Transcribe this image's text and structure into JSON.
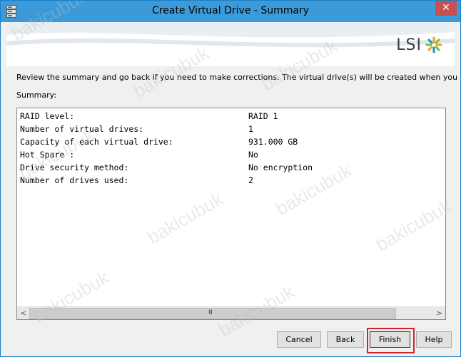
{
  "window": {
    "title": "Create Virtual Drive - Summary",
    "close_glyph": "✕",
    "app_icon": "server-stack-icon"
  },
  "banner": {
    "logo_text": "LSI",
    "logo_icon": "lsi-starburst-icon"
  },
  "description": "Review the summary and go back if you need to make corrections. The virtual drive(s) will be created when you click finish.",
  "summary_label": "Summary:",
  "summary_rows": [
    {
      "key": "RAID level:",
      "value": "RAID 1"
    },
    {
      "key": "Number of virtual drives:",
      "value": "1"
    },
    {
      "key": "Capacity of each virtual drive:",
      "value": "931.000 GB"
    },
    {
      "key": "Hot Spare :",
      "value": "No"
    },
    {
      "key": "Drive security method:",
      "value": "No encryption"
    },
    {
      "key": "Number of drives used:",
      "value": "2"
    }
  ],
  "scrollbar": {
    "left_arrow": "<",
    "right_arrow": ">",
    "grip": "III"
  },
  "buttons": {
    "cancel": "Cancel",
    "back": "Back",
    "finish": "Finish",
    "help": "Help"
  },
  "watermark": "bakicubuk",
  "colors": {
    "titlebar": "#3d9ad9",
    "close_button": "#c75050",
    "finish_highlight": "#d2232a"
  }
}
